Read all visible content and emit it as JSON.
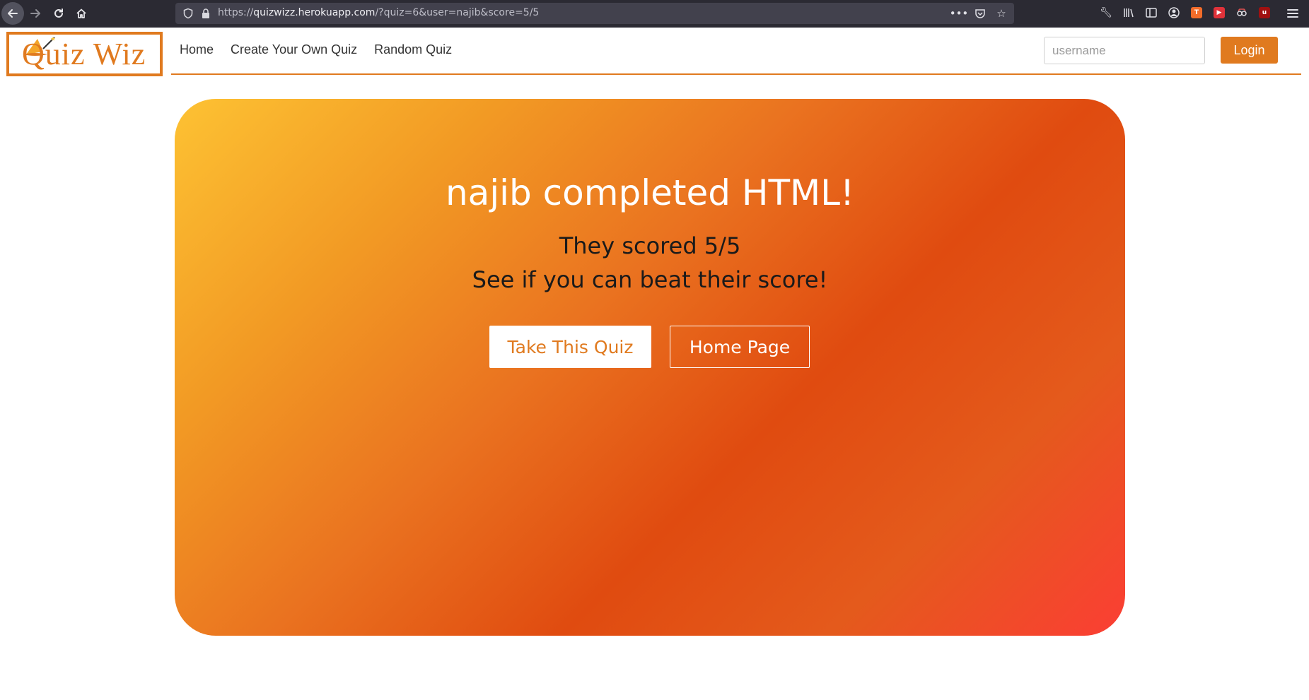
{
  "browser": {
    "url_prefix": "https://",
    "url_host": "quizwizz.herokuapp.com",
    "url_path": "/?quiz=6&user=najib&score=5/5",
    "icons": [
      "back-icon",
      "forward-icon",
      "reload-icon",
      "home-icon",
      "shield-icon",
      "lock-icon",
      "more-icon",
      "pocket-icon",
      "star-icon",
      "wrench-icon",
      "library-icon",
      "sidebar-icon",
      "account-icon",
      "extension-icon",
      "menu-icon"
    ]
  },
  "nav": {
    "logo_text": "Quiz Wiz",
    "links": [
      "Home",
      "Create Your Own Quiz",
      "Random Quiz"
    ],
    "username_placeholder": "username",
    "login_label": "Login",
    "accent_color": "#e07a1f"
  },
  "result": {
    "title": "najib completed HTML!",
    "score_line": "They scored 5/5",
    "challenge_line": "See if you can beat their score!",
    "take_quiz_label": "Take This Quiz",
    "home_page_label": "Home Page"
  }
}
